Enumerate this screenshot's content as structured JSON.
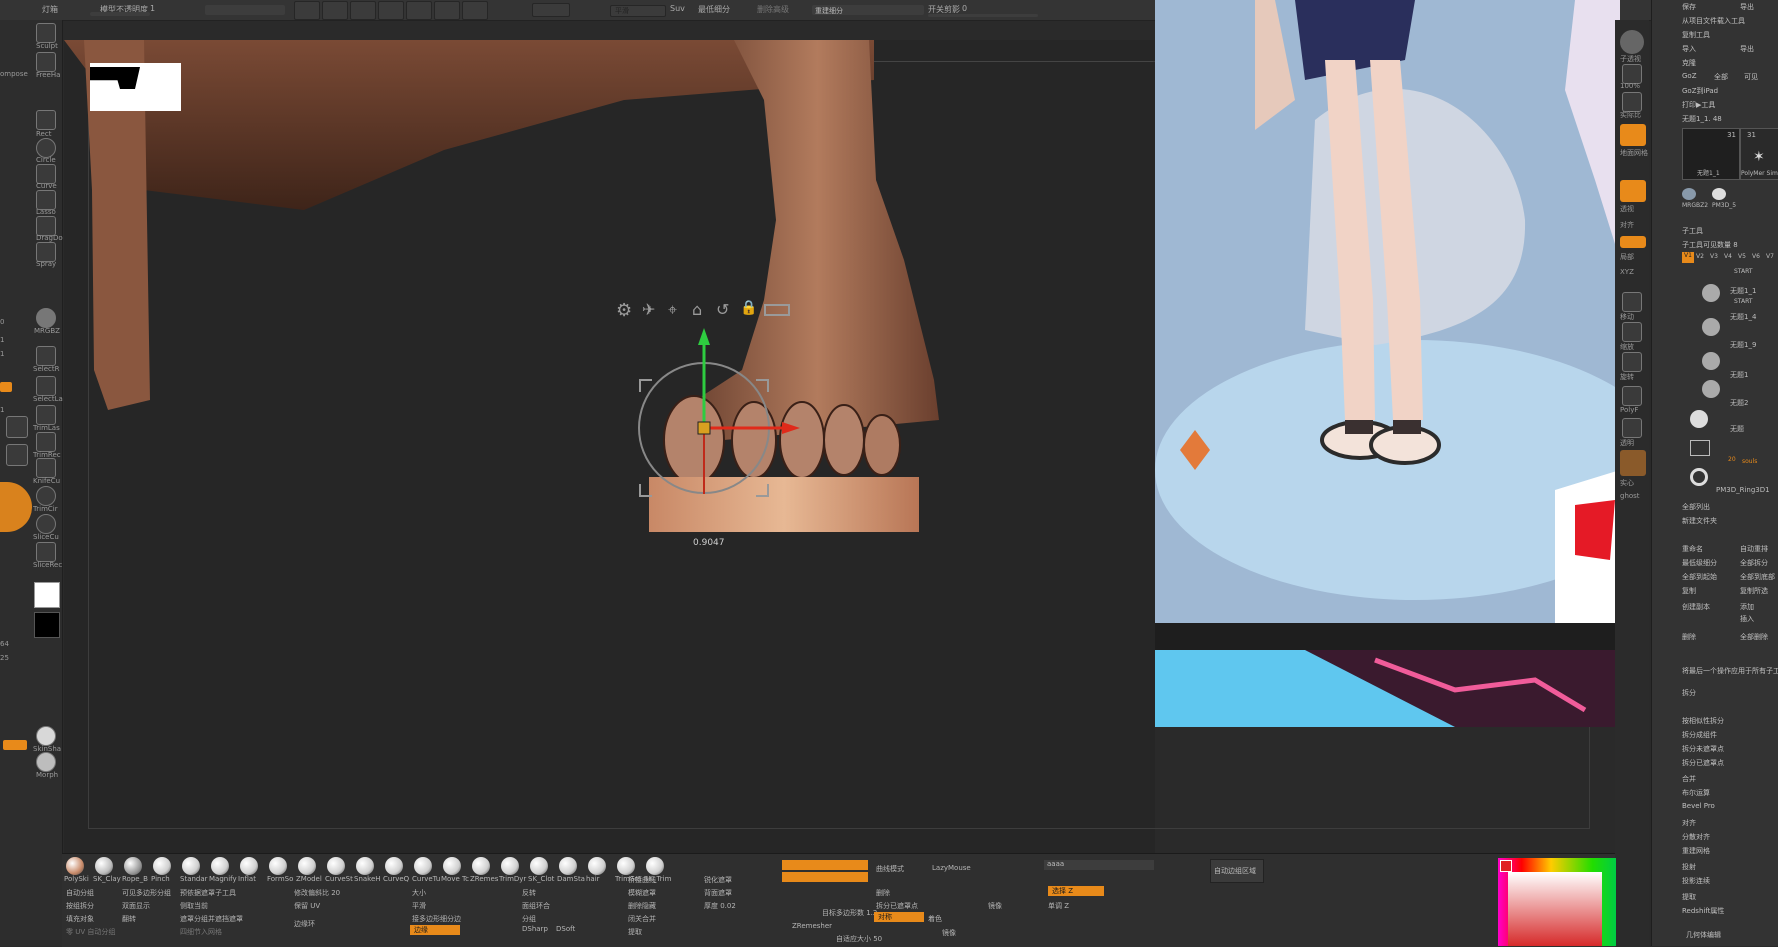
{
  "top": {
    "light_label": "灯箱",
    "model_opacity_label": "模型不透明度",
    "model_opacity_value": "1",
    "smooth_label": "平滑",
    "suv_label": "Suv",
    "smart_subdiv_label": "最低细分",
    "remove_label": "删除高级",
    "resubdiv_label": "重建细分",
    "upper_opacity_label": "开关剪影",
    "upper_opacity_value": "0"
  },
  "canvas": {
    "gizmo_readout": "0.9047"
  },
  "left_tools": [
    {
      "label": "Sculpt"
    },
    {
      "label": "FreeHa"
    },
    {
      "label": "Rect"
    },
    {
      "label": "Circle"
    },
    {
      "label": "Curve"
    },
    {
      "label": "Lasso"
    },
    {
      "label": "DragDo"
    },
    {
      "label": "Spray"
    },
    {
      "label": "MRGBZ"
    },
    {
      "label": "SelectR"
    },
    {
      "label": "SelectLa"
    },
    {
      "label": "TrimLas"
    },
    {
      "label": "TrimRec"
    },
    {
      "label": "KnifeCu"
    },
    {
      "label": "TrimCir"
    },
    {
      "label": "SliceCu"
    },
    {
      "label": "SliceRec"
    },
    {
      "label": "SkinSha"
    },
    {
      "label": "Morph"
    }
  ],
  "left_readouts": {
    "compose": "ompose",
    "zadd": "zdis",
    "value_64": "64",
    "value_25": "25",
    "value_0": "0",
    "value_1a": "1",
    "value_1b": "1",
    "value_1c": "1"
  },
  "right_panel": {
    "items": [
      "保存",
      "从项目文件载入工具",
      "复制工具",
      "导入",
      "克隆",
      "GoZ",
      "GoZ到iPad",
      "打印▶工具",
      "无题1_1. 48",
      "子工具",
      "子工具可见数量 8",
      "无题1_1",
      "无题1_4",
      "无题1_9",
      "无题1",
      "无题2",
      "无题",
      "PM3D_Ring3D1",
      "全部列出",
      "新建文件夹",
      "重命名",
      "最低级细分",
      "全部到起始",
      "复制",
      "创建副本",
      "删除",
      "将最后一个操作应用于所有子工具",
      "拆分",
      "按相似性拆分",
      "拆分成组件",
      "拆分未遮罩点",
      "拆分已遮罩点",
      "合并",
      "布尔运算",
      "Bevel Pro",
      "对齐",
      "分散对齐",
      "重建网格",
      "投射",
      "投影连续",
      "提取",
      "Redshift属性",
      "几何体编辑"
    ],
    "right_col": [
      "导出",
      "全部",
      "可见",
      "添加",
      "插入",
      "全部删除",
      "复制所选",
      "全部到底部",
      "全部拆分",
      "自动重排"
    ],
    "subtool_thumbs": [
      "31",
      "31"
    ],
    "v_tabs": [
      "V1",
      "V2",
      "V3",
      "V4",
      "V5",
      "V6",
      "V7"
    ],
    "thumb_caption_a": "无题1_1",
    "thumb_caption_b": "PolyMer Sim",
    "thumb_caption_c": "MRGBZ2",
    "thumb_caption_d": "PM3D_5",
    "start_label": "START",
    "souls_label": "souls",
    "souls_count": "20"
  },
  "right_strip": [
    "子透视",
    "100%",
    "实际比",
    "地面网格",
    "透视",
    "对齐",
    "局部",
    "XYZ",
    "移动",
    "缩放",
    "旋转",
    "PolyF",
    "透明",
    "实心",
    "ghost"
  ],
  "brushes": [
    {
      "label": "PolySki",
      "color": "#c98b6a"
    },
    {
      "label": "SK_Clay",
      "color": "#bdbdbd"
    },
    {
      "label": "Rope_B",
      "color": "#9a9a9a"
    },
    {
      "label": "Pinch",
      "color": "#cfcfcf"
    },
    {
      "label": "Standar",
      "color": "#cfcfcf"
    },
    {
      "label": "Magnify",
      "color": "#cfcfcf"
    },
    {
      "label": "Inflat",
      "color": "#cfcfcf"
    },
    {
      "label": "FormSo",
      "color": "#cfcfcf"
    },
    {
      "label": "ZModel",
      "color": "#cfcfcf"
    },
    {
      "label": "CurveSt",
      "color": "#cfcfcf"
    },
    {
      "label": "SnakeH",
      "color": "#cfcfcf"
    },
    {
      "label": "CurveQ",
      "color": "#cfcfcf"
    },
    {
      "label": "CurveTu",
      "color": "#cfcfcf"
    },
    {
      "label": "Move Tc",
      "color": "#cfcfcf"
    },
    {
      "label": "ZRemes",
      "color": "#cfcfcf"
    },
    {
      "label": "TrimDyr",
      "color": "#cfcfcf"
    },
    {
      "label": "SK_Clot",
      "color": "#cfcfcf"
    },
    {
      "label": "DamSta",
      "color": "#cfcfcf"
    },
    {
      "label": "hair",
      "color": "#cfcfcf"
    },
    {
      "label": "TrimSm",
      "color": "#cfcfcf"
    },
    {
      "label": "SK_Trim",
      "color": "#cfcfcf"
    }
  ],
  "bottom_rows": {
    "col1": [
      "自动分组",
      "按组拆分",
      "填充对象",
      "零 UV 自动分组"
    ],
    "col2": [
      "可见多边形分组",
      "双面显示",
      "翻转"
    ],
    "col3": [
      "预依据遮罩子工具",
      "侧取当前",
      "遮罩分组并遮挡遮罩",
      "四细节入网格"
    ],
    "col4": [
      "修改偏斜比 20",
      "保留 UV",
      "边缘环"
    ],
    "col5": [
      "大小",
      "平滑",
      "接多边形细分边",
      "边缘",
      "边界环"
    ],
    "col6": [
      "反转",
      "面组环合",
      "分组",
      "附细"
    ],
    "col7": [
      "桥接曲线",
      "模糊遮罩",
      "删除隐藏",
      "闭关合并",
      "提取"
    ],
    "col8": [
      "锐化遮罩",
      "背面遮罩",
      "厚度 0.02"
    ],
    "col9": [
      "曲线模式",
      "ZRemesher",
      "自适应大小 50"
    ],
    "col10": [
      "LazyMouse",
      "删除",
      "拆分已遮罩点",
      "对称"
    ],
    "col11": [
      "aaaa",
      "镜像",
      "单调 Z"
    ],
    "col12": [
      "自动边组区域"
    ],
    "orange_a": "边缘",
    "orange_b": "对称",
    "orange_c": "选择 Z",
    "target_poly": "目标多边形数 1.2",
    "dsharp": "DSharp",
    "dsoft": "DSoft",
    "color_label": "着色",
    "deform_label": "镜像"
  },
  "colors": {
    "accent": "#e88a1a",
    "panel": "#333333",
    "canvas": "#262626",
    "gizmo_green": "#2ecc40",
    "gizmo_red": "#e02a1a",
    "skin": "#a87054"
  }
}
